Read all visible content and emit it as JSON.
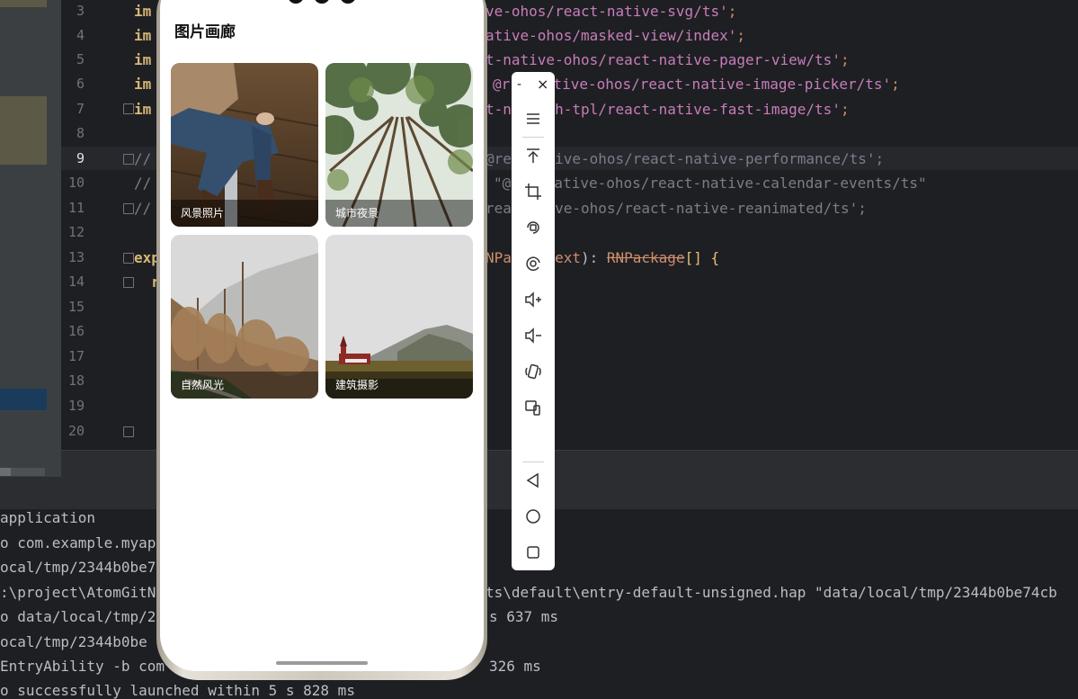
{
  "editor": {
    "line_numbers": [
      "3",
      "4",
      "5",
      "6",
      "7",
      "8",
      "9",
      "10",
      "11",
      "12",
      "13",
      "14",
      "15",
      "16",
      "17",
      "18",
      "19",
      "20"
    ],
    "current_line": "9",
    "lines": {
      "l3": {
        "kw": "im",
        "str": "ve-ohos/react-native-svg/ts'",
        "end": ";"
      },
      "l4": {
        "kw": "im",
        "str": "ative-ohos/masked-view/index'",
        "end": ";"
      },
      "l5": {
        "kw": "im",
        "str": "t-native-ohos/react-native-pager-view/ts'",
        "end": ";"
      },
      "l6": {
        "kw": "im",
        "str": "@r   native-ohos/react-native-image-picker/ts'",
        "end": ";"
      },
      "l7": {
        "kw": "im",
        "str": "t-n   -oh-tpl/react-native-fast-image/ts'",
        "end": ";"
      },
      "l9": {
        "cm1": "//",
        "cm2": "@re   ative-ohos/react-native-performance/ts';"
      },
      "l10": {
        "cm1": "//",
        "cm2": "\"@   -native-ohos/react-native-calendar-events/ts\""
      },
      "l11": {
        "cm1": "//",
        "cm2": "rea   tive-ohos/react-native-reanimated/ts';"
      },
      "l13": {
        "kw": "exp",
        "part1": "NPa",
        "part2": " Context",
        "part3": "): ",
        "type": "RNPackage",
        "tail": "[] {"
      },
      "l14": {
        "kw": "r"
      }
    }
  },
  "console": {
    "lines": [
      "application",
      "o com.example.myap",
      "ocal/tmp/2344b0be7",
      ":\\project\\AtomGitN",
      "o data/local/tmp/2",
      "ocal/tmp/2344b0be",
      "EntryAbility -b com",
      "o successfully launched within 5 s 828 ms"
    ],
    "right_lines": {
      "r4": "ts\\default\\entry-default-unsigned.hap \"data/local/tmp/2344b0be74cb",
      "r5": "s 637 ms",
      "r7": "326 ms"
    }
  },
  "app": {
    "title": "图片画廊",
    "cards": [
      {
        "label": "风景照片"
      },
      {
        "label": "城市夜景"
      },
      {
        "label": "自然风光"
      },
      {
        "label": "建筑摄影"
      }
    ]
  },
  "emulator_toolbar": {
    "minimize": "-",
    "close": "×",
    "icons": [
      "menu-icon",
      "to-top-icon",
      "crop-icon",
      "rotate-icon",
      "screenshot-icon",
      "volume-up-icon",
      "volume-down-icon",
      "shake-icon",
      "multi-device-icon",
      "back-icon",
      "home-icon",
      "recents-icon"
    ]
  }
}
